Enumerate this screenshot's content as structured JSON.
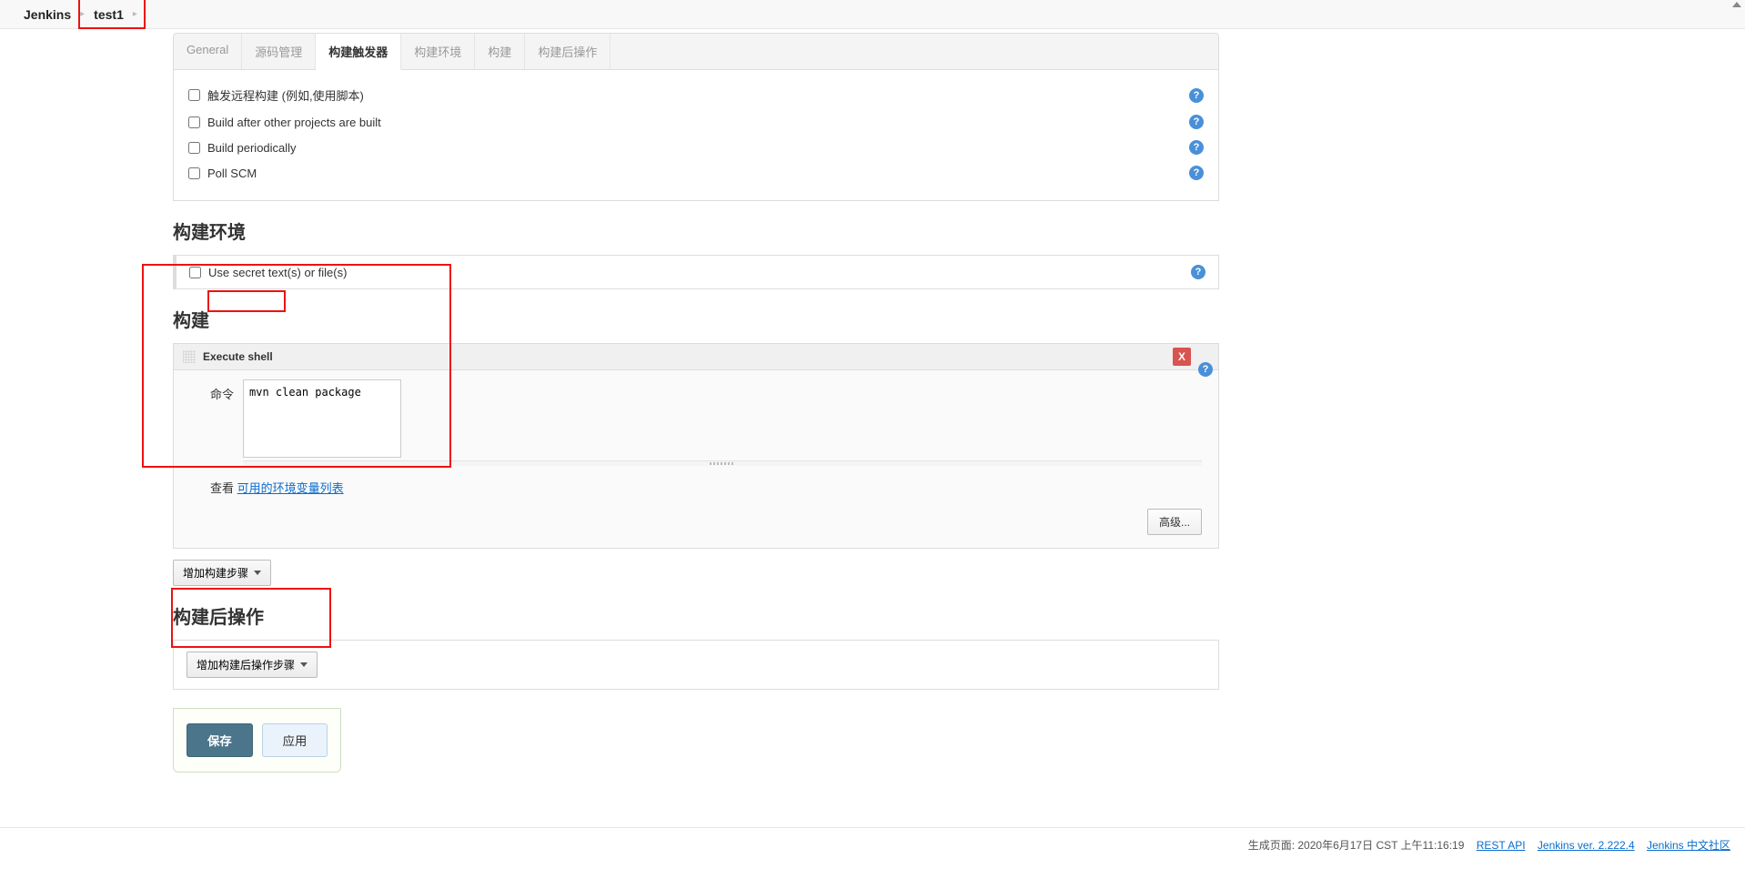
{
  "breadcrumb": {
    "root": "Jenkins",
    "item": "test1"
  },
  "tabs": [
    "General",
    "源码管理",
    "构建触发器",
    "构建环境",
    "构建",
    "构建后操作"
  ],
  "activeTabIndex": 2,
  "triggers": [
    {
      "label": "触发远程构建 (例如,使用脚本)",
      "help": true
    },
    {
      "label": "Build after other projects are built",
      "help": true
    },
    {
      "label": "Build periodically",
      "help": true
    },
    {
      "label": "Poll SCM",
      "help": true
    }
  ],
  "sections": {
    "buildEnv": "构建环境",
    "build": "构建",
    "postBuild": "构建后操作"
  },
  "env": {
    "option": "Use secret text(s) or file(s)"
  },
  "buildStep": {
    "title": "Execute shell",
    "cmdLabel": "命令",
    "cmdValue": "mvn clean package",
    "seeText": "查看 ",
    "envLink": "可用的环境变量列表",
    "advanced": "高级...",
    "deleteLabel": "X"
  },
  "buttons": {
    "addBuildStep": "增加构建步骤",
    "addPostBuildStep": "增加构建后操作步骤",
    "save": "保存",
    "apply": "应用"
  },
  "footer": {
    "genText": "生成页面: 2020年6月17日 CST 上午11:16:19",
    "restApi": "REST API",
    "version": "Jenkins ver. 2.222.4",
    "community": "Jenkins 中文社区"
  }
}
